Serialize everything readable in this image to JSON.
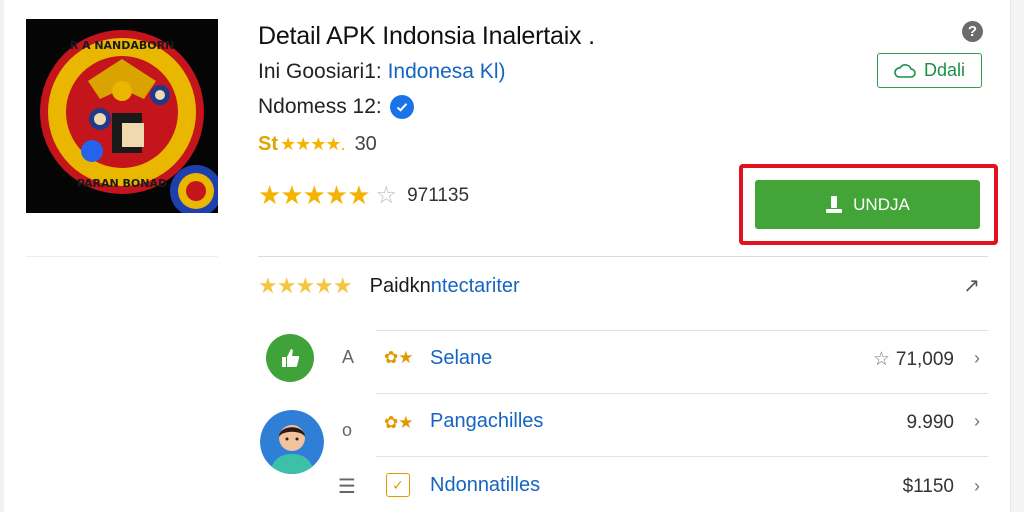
{
  "app": {
    "title": "Detail APK Indonsia  Inalertaix   .",
    "developer_prefix": "Ini Goosiari1: ",
    "developer_link": "Indonesa Kl)",
    "publisher": "Ndomess 12:",
    "rating_label": "St",
    "rating_stars": "★★★★.",
    "rating_value": "30",
    "stars_full": "★★★★★",
    "star_empty": "☆",
    "review_count": "971135",
    "icon_name": "garuda-emblem-icon"
  },
  "actions": {
    "help": "?",
    "detail_label": "Ddali",
    "download_label": "UNDJA"
  },
  "reviews": {
    "stars": "★★★★★",
    "label_a": "Paidkn",
    "label_b": "ntectariter",
    "arrow": "↗",
    "rows": [
      {
        "letter": "A",
        "icon": "👍",
        "name": "Selane",
        "value": "71,009",
        "has_star": true
      },
      {
        "letter": "o",
        "icon": "⚙",
        "name": "Pangachilles",
        "value": "9.990",
        "has_star": false
      },
      {
        "letter": "☰",
        "icon": "✓",
        "name": "Ndonnatilles",
        "value": "$1150",
        "has_star": false
      }
    ]
  },
  "colors": {
    "accent_green": "#43a537",
    "highlight_red": "#e0121e",
    "link_blue": "#1565c0",
    "star_gold": "#f5b301"
  }
}
